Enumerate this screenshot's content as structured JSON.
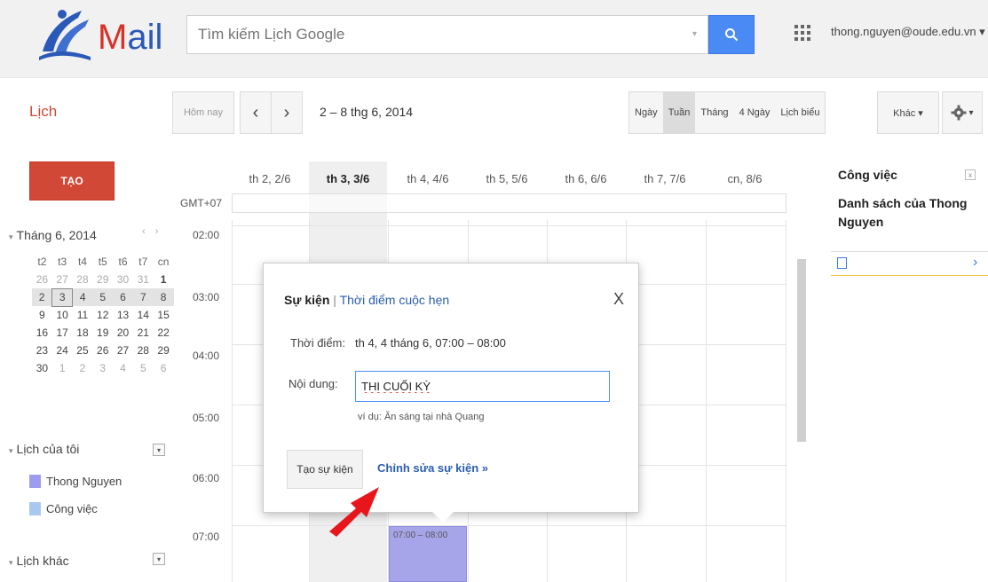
{
  "header": {
    "logo_letter": "M",
    "logo_rest": "ail",
    "search_placeholder": "Tìm kiếm Lịch Google",
    "search_dropdown": "▾",
    "account": "thong.nguyen@oude.edu.vn ▾"
  },
  "toolbar": {
    "app_title": "Lịch",
    "today": "Hôm nay",
    "prev": "‹",
    "next": "›",
    "date_range": "2 – 8 thg 6, 2014",
    "views": [
      "Ngày",
      "Tuần",
      "Tháng",
      "4 Ngày",
      "Lịch biểu"
    ],
    "active_view": "Tuần",
    "more": "Khác ▾",
    "settings_caret": "▾"
  },
  "sidebar": {
    "create": "TẠO",
    "mini_cal": {
      "title": "Tháng 6, 2014",
      "nav": "‹ ›",
      "weekdays": [
        "t2",
        "t3",
        "t4",
        "t5",
        "t6",
        "t7",
        "cn"
      ],
      "weeks": [
        [
          "26",
          "27",
          "28",
          "29",
          "30",
          "31",
          "1"
        ],
        [
          "2",
          "3",
          "4",
          "5",
          "6",
          "7",
          "8"
        ],
        [
          "9",
          "10",
          "11",
          "12",
          "13",
          "14",
          "15"
        ],
        [
          "16",
          "17",
          "18",
          "19",
          "20",
          "21",
          "22"
        ],
        [
          "23",
          "24",
          "25",
          "26",
          "27",
          "28",
          "29"
        ],
        [
          "30",
          "1",
          "2",
          "3",
          "4",
          "5",
          "6"
        ]
      ],
      "today": "3"
    },
    "my_calendars": {
      "title": "Lịch của tôi",
      "items": [
        {
          "label": "Thong Nguyen",
          "color": "#9e9ded"
        },
        {
          "label": "Công việc",
          "color": "#a8c8f0"
        }
      ]
    },
    "other_calendars": {
      "title": "Lịch khác"
    },
    "section_caret": "▾",
    "section_menu": "▾"
  },
  "grid": {
    "timezone": "GMT+07",
    "days": [
      "th 2, 2/6",
      "th 3, 3/6",
      "th 4, 4/6",
      "th 5, 5/6",
      "th 6, 6/6",
      "th 7, 7/6",
      "cn, 8/6"
    ],
    "selected_day": "th 3, 3/6",
    "hours": [
      "02:00",
      "03:00",
      "04:00",
      "05:00",
      "06:00",
      "07:00"
    ],
    "event": {
      "label": "07:00 – 08:00",
      "color": "#a7a5e9"
    }
  },
  "popup": {
    "tab_event": "Sự kiện",
    "tab_sep": " | ",
    "tab_appointment": "Thời điểm cuộc hẹn",
    "close": "X",
    "when_label": "Thời điểm:",
    "when_value": "th 4, 4 tháng 6, 07:00 – 08:00",
    "what_label": "Nội dung:",
    "what_value": "THI CUỐI KỲ",
    "example": "ví dụ: Ăn sáng tại nhà Quang",
    "create_button": "Tạo sự kiện",
    "edit_link": "Chỉnh sửa sự kiện »"
  },
  "tasks": {
    "title": "Công việc",
    "close": "x",
    "list_name": "Danh sách của Thong Nguyen",
    "chevron": "›"
  },
  "colors": {
    "brand_red": "#d14836",
    "link_blue": "#2a5db0",
    "search_blue": "#4a8af4",
    "arrow_red": "#e8151b"
  }
}
